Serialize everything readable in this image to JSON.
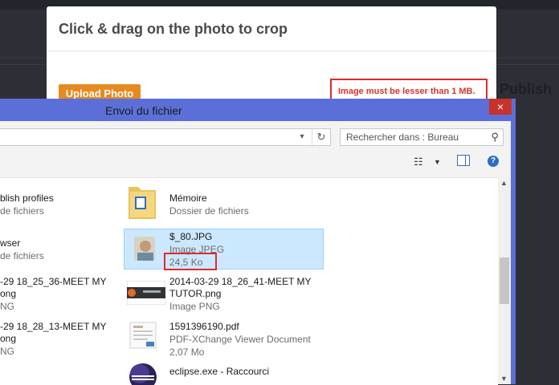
{
  "page": {
    "publish_label": "Publish"
  },
  "crop_modal": {
    "title": "Click & drag on the photo to crop",
    "upload_button": "Upload Photo",
    "error_message": "Image must be lesser than 1 MB."
  },
  "dialog": {
    "title": "Envoi du fichier",
    "close_label": "×",
    "search_placeholder": "Rechercher dans : Bureau",
    "left_column": [
      {
        "name": "blish profiles",
        "meta": "de fichiers"
      },
      {
        "name": "wser",
        "meta": "de fichiers"
      },
      {
        "name": "-29 18_25_36-MEET MY",
        "name2": "ong",
        "meta": "NG"
      },
      {
        "name": "-29 18_28_13-MEET MY",
        "name2": "ong",
        "meta": "NG"
      }
    ],
    "right_column": [
      {
        "name": "Mémoire",
        "meta": "Dossier de fichiers",
        "icon": "folder-icon"
      },
      {
        "name": "$_80.JPG",
        "meta": "Image JPEG",
        "size": "24,5 Ko",
        "icon": "photo-thumbnail",
        "selected": true
      },
      {
        "name": "2014-03-29 18_26_41-MEET MY",
        "name2": "TUTOR.png",
        "meta": "Image PNG",
        "icon": "screenshot-thumbnail"
      },
      {
        "name": "1591396190.pdf",
        "meta": "PDF-XChange Viewer Document",
        "size": "2,07 Mo",
        "icon": "pdf-icon"
      },
      {
        "name": "eclipse.exe - Raccourci",
        "icon": "eclipse-icon"
      }
    ]
  },
  "colors": {
    "dialog_frame": "#5c6fd8",
    "close_button": "#c7322b",
    "upload_button": "#e68a20",
    "error_text": "#d9342b",
    "selection": "#cce8ff"
  }
}
